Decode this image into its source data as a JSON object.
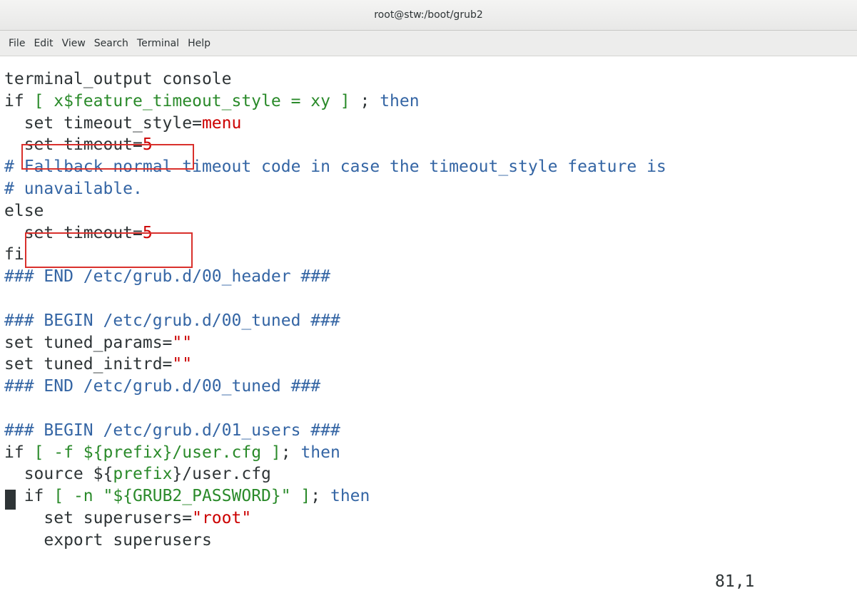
{
  "window": {
    "title": "root@stw:/boot/grub2"
  },
  "menu": [
    "File",
    "Edit",
    "View",
    "Search",
    "Terminal",
    "Help"
  ],
  "lines": [
    [
      {
        "t": "terminal_output console",
        "c": "t"
      }
    ],
    [
      {
        "t": "if ",
        "c": "t"
      },
      {
        "t": "[ x$feature_timeout_style = xy ]",
        "c": "kw"
      },
      {
        "t": " ; ",
        "c": "t"
      },
      {
        "t": "then",
        "c": "cm"
      }
    ],
    [
      {
        "t": "  set timeout_style=",
        "c": "t"
      },
      {
        "t": "menu",
        "c": "st"
      }
    ],
    [
      {
        "t": "  set timeout=",
        "c": "t"
      },
      {
        "t": "5",
        "c": "st"
      }
    ],
    [
      {
        "t": "# Fallback normal timeout code in case the timeout_style feature is",
        "c": "cm"
      }
    ],
    [
      {
        "t": "# unavailable.",
        "c": "cm"
      }
    ],
    [
      {
        "t": "else",
        "c": "t"
      }
    ],
    [
      {
        "t": "  set timeout=",
        "c": "t"
      },
      {
        "t": "5",
        "c": "st"
      }
    ],
    [
      {
        "t": "fi",
        "c": "t"
      }
    ],
    [
      {
        "t": "### END /etc/grub.d/00_header ###",
        "c": "cm"
      }
    ],
    [
      {
        "t": "",
        "c": "t"
      }
    ],
    [
      {
        "t": "### BEGIN /etc/grub.d/00_tuned ###",
        "c": "cm"
      }
    ],
    [
      {
        "t": "set tuned_params=",
        "c": "t"
      },
      {
        "t": "\"\"",
        "c": "st"
      }
    ],
    [
      {
        "t": "set tuned_initrd=",
        "c": "t"
      },
      {
        "t": "\"\"",
        "c": "st"
      }
    ],
    [
      {
        "t": "### END /etc/grub.d/00_tuned ###",
        "c": "cm"
      }
    ],
    [
      {
        "t": "",
        "c": "t"
      }
    ],
    [
      {
        "t": "### BEGIN /etc/grub.d/01_users ###",
        "c": "cm"
      }
    ],
    [
      {
        "t": "if ",
        "c": "t"
      },
      {
        "t": "[ -f ",
        "c": "kw"
      },
      {
        "t": "${prefix}",
        "c": "kw"
      },
      {
        "t": "/user.cfg ]",
        "c": "kw"
      },
      {
        "t": "; ",
        "c": "t"
      },
      {
        "t": "then",
        "c": "cm"
      }
    ],
    [
      {
        "t": "  source ${",
        "c": "t"
      },
      {
        "t": "prefix",
        "c": "kw"
      },
      {
        "t": "}/user.cfg",
        "c": "t"
      }
    ],
    [
      {
        "t": "  if ",
        "c": "t"
      },
      {
        "t": "[ -n \"${GRUB2_PASSWORD}\" ]",
        "c": "kw"
      },
      {
        "t": "; ",
        "c": "t"
      },
      {
        "t": "then",
        "c": "cm"
      }
    ],
    [
      {
        "t": "    set superusers=",
        "c": "t"
      },
      {
        "t": "\"root\"",
        "c": "st"
      }
    ],
    [
      {
        "t": "    export superusers",
        "c": "t"
      }
    ]
  ],
  "status": {
    "position": "81,1"
  },
  "colors": {
    "keyword": "#2a8a2a",
    "comment": "#3465a4",
    "string": "#cc0000",
    "highlight_box": "#d9302c"
  }
}
